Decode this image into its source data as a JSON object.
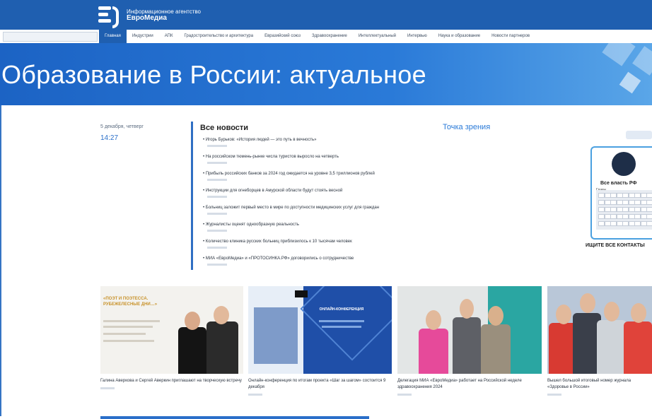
{
  "logo": {
    "line1": "Информационное агентство",
    "line2": "ЕвроМедиа"
  },
  "nav": {
    "items": [
      {
        "label": "Главная",
        "active": true
      },
      {
        "label": "Индустрии"
      },
      {
        "label": "АПК"
      },
      {
        "label": "Градостроительство и архитектура"
      },
      {
        "label": "Евразийский союз"
      },
      {
        "label": "Здравоохранение"
      },
      {
        "label": "Интеллектуальный"
      },
      {
        "label": "Интервью"
      },
      {
        "label": "Наука и образование"
      },
      {
        "label": "Новости партнеров"
      }
    ]
  },
  "hero": {
    "title": "Образование в России: актуальное"
  },
  "datetime": {
    "date": "5 декабря, четверг",
    "time": "14:27"
  },
  "news": {
    "title": "Все новости",
    "point_of_view": "Точка зрения",
    "items": [
      "• Игорь Бурьков: «История людей — это путь в вечность»",
      "• На российском тюмень-рынке числа туристов выросло на четверть",
      "• Прибыль российских банков за 2024 год ожидается на уровне 3,5 триллионов рублей",
      "• Инструкции для огнеборцев в Амурской области будут стоять весной",
      "• Больниц заложит первый место в мире по доступности медицинских услуг для граждан",
      "• Журналисты оценят однообразную реальность",
      "• Количество клиника русских больниц приблизилось к 10 тысячам человек",
      "• МИА «ЕвроМедиа» и «ПРОТОСИНКА.РФ» договорились о сотрудничестве"
    ]
  },
  "widget": {
    "name": "Все власть РФ",
    "section": "Главы",
    "search_label": "ИЩИТЕ ВСЕ КОНТАКТЫ"
  },
  "cards": [
    {
      "caption": "Галина Аверкова и Сергей Аверкин приглашают на творческую встречу",
      "poster_title": "«ПОЭТ И ПОЭТЕССА. РУБЕЖЕЛЕСНЫЕ ДНИ…»"
    },
    {
      "caption": "Онлайн-конференция по итогам проекта «Шаг за шагом» состоится 9 декабря",
      "poster_title": "ОНЛАЙН-КОНФЕРЕНЦИЯ"
    },
    {
      "caption": "Делегация МИА «ЕвроМедиа» работает на Российской неделе здравоохранения 2024",
      "poster_title": ""
    },
    {
      "caption": "Вышел большой итоговый номер журнала «Здоровье в России»",
      "poster_title": ""
    }
  ]
}
